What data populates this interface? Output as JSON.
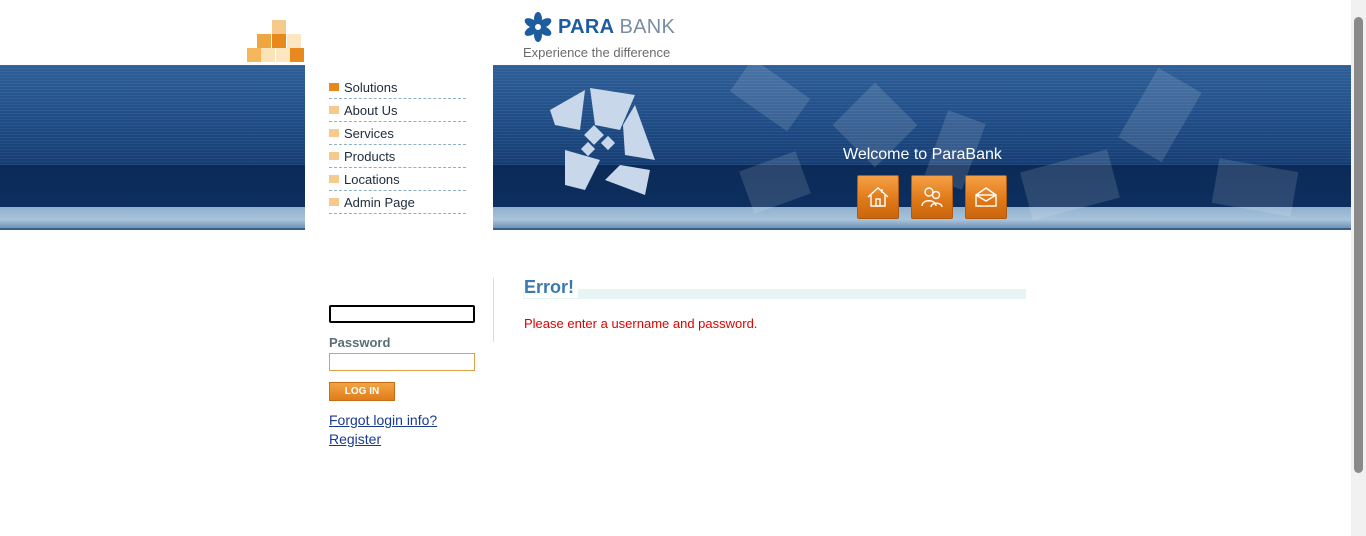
{
  "brand": {
    "name_part1": "PARA",
    "name_part2": "BANK",
    "tagline": "Experience the difference"
  },
  "nav": {
    "items": [
      {
        "label": "Solutions"
      },
      {
        "label": "About Us"
      },
      {
        "label": "Services"
      },
      {
        "label": "Products"
      },
      {
        "label": "Locations"
      },
      {
        "label": "Admin Page"
      }
    ]
  },
  "header": {
    "welcome": "Welcome to ParaBank",
    "icons": [
      "home-icon",
      "contact-people-icon",
      "envelope-icon"
    ]
  },
  "login": {
    "username_value": "",
    "password_label": "Password",
    "password_value": "",
    "button_label": "LOG IN",
    "forgot_link": "Forgot login info?",
    "register_link": "Register"
  },
  "main": {
    "error_title": "Error!",
    "error_message": "Please enter a username and password."
  },
  "colors": {
    "accent_orange": "#e8891d",
    "brand_blue": "#1d5c9e",
    "error_red": "#e00000",
    "title_blue": "#3a7ab0"
  }
}
